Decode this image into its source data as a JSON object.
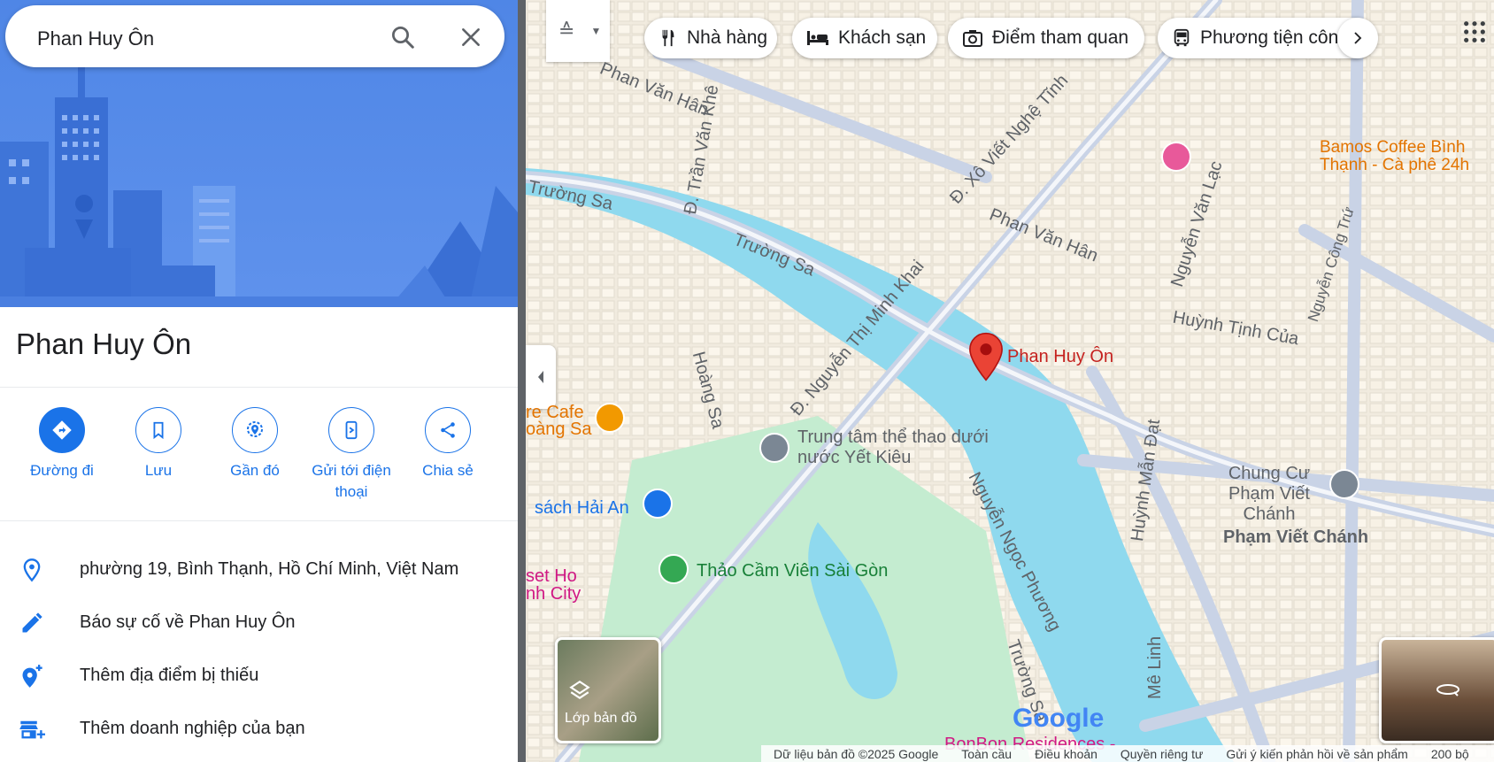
{
  "search": {
    "query": "Phan Huy Ôn"
  },
  "place": {
    "title": "Phan Huy Ôn"
  },
  "actions": [
    {
      "label": "Đường đi"
    },
    {
      "label": "Lưu"
    },
    {
      "label": "Gần đó"
    },
    {
      "label": "Gửi tới điện thoại"
    },
    {
      "label": "Chia sẻ"
    }
  ],
  "info_rows": [
    {
      "icon": "location-pin-icon",
      "text": "phường 19, Bình Thạnh, Hồ Chí Minh, Việt Nam"
    },
    {
      "icon": "pencil-icon",
      "text": "Báo sự cố về Phan Huy Ôn"
    },
    {
      "icon": "add-location-icon",
      "text": "Thêm địa điểm bị thiếu"
    },
    {
      "icon": "add-business-icon",
      "text": "Thêm doanh nghiệp của bạn"
    }
  ],
  "chips": [
    {
      "label": "Nhà hàng",
      "icon": "fork-knife-icon"
    },
    {
      "label": "Khách sạn",
      "icon": "bed-icon"
    },
    {
      "label": "Điểm tham quan",
      "icon": "camera-icon"
    },
    {
      "label": "Phương tiện công cộng",
      "icon": "bus-icon"
    }
  ],
  "map_labels": {
    "pin": "Phan Huy Ôn",
    "bamos": "Bamos Coffee Bình Thạnh - Cà phê 24h",
    "trung_tam": "Trung tâm thể thao dưới nước Yết Kiêu",
    "chung_cu": "Chung Cư Phạm Viết Chánh",
    "thao_cam_vien": "Thảo Cầm Viên Sài Gòn",
    "sach": "sách Hải An",
    "cafe": "re Cafe",
    "cafe2": "oàng Sa",
    "sunset": "set Ho",
    "sunset2": "nh City",
    "bonbon": "BonBon Residences -",
    "streets": {
      "phan_van_han_1": "Phan Văn Hân",
      "phan_van_han_2": "Phan Văn Hân",
      "tran_van_khe": "Đ. Trần Văn Khê",
      "truong_sa_1": "Trường Sa",
      "truong_sa_2": "Trường Sa",
      "truong_sa_3": "Trường Sa",
      "xo_viet": "Đ. Xô Viết Nghệ Tĩnh",
      "nguyen_van_lac": "Nguyễn Văn Lạc",
      "nguyen_cong_tru": "Nguyễn Công Trứ",
      "huynh_tinh_cua": "Huỳnh Tịnh Của",
      "nguyen_thi_minh_khai": "Đ. Nguyễn Thị Minh Khai",
      "hoang_sa": "Hoàng Sa",
      "huynh_man_dat": "Huỳnh Mẫn Đạt",
      "pham_viet_chanh": "Phạm Viết Chánh",
      "nguyen_ngoc_phuong": "Nguyễn Ngọc Phương",
      "me_linh": "Mê Linh"
    }
  },
  "layers_label": "Lớp bản đồ",
  "google_logo": "Google",
  "footer": [
    "Dữ liệu bản đồ ©2025 Google",
    "Toàn cầu",
    "Điều khoản",
    "Quyền riêng tư",
    "Gửi ý kiến phản hồi về sản phẩm",
    "200 bộ"
  ],
  "colors": {
    "accent": "#1a73e8",
    "water": "#8fd9ee",
    "park": "#c4ecd0",
    "pin": "#ea4335",
    "pinLabel": "#c5221f"
  }
}
